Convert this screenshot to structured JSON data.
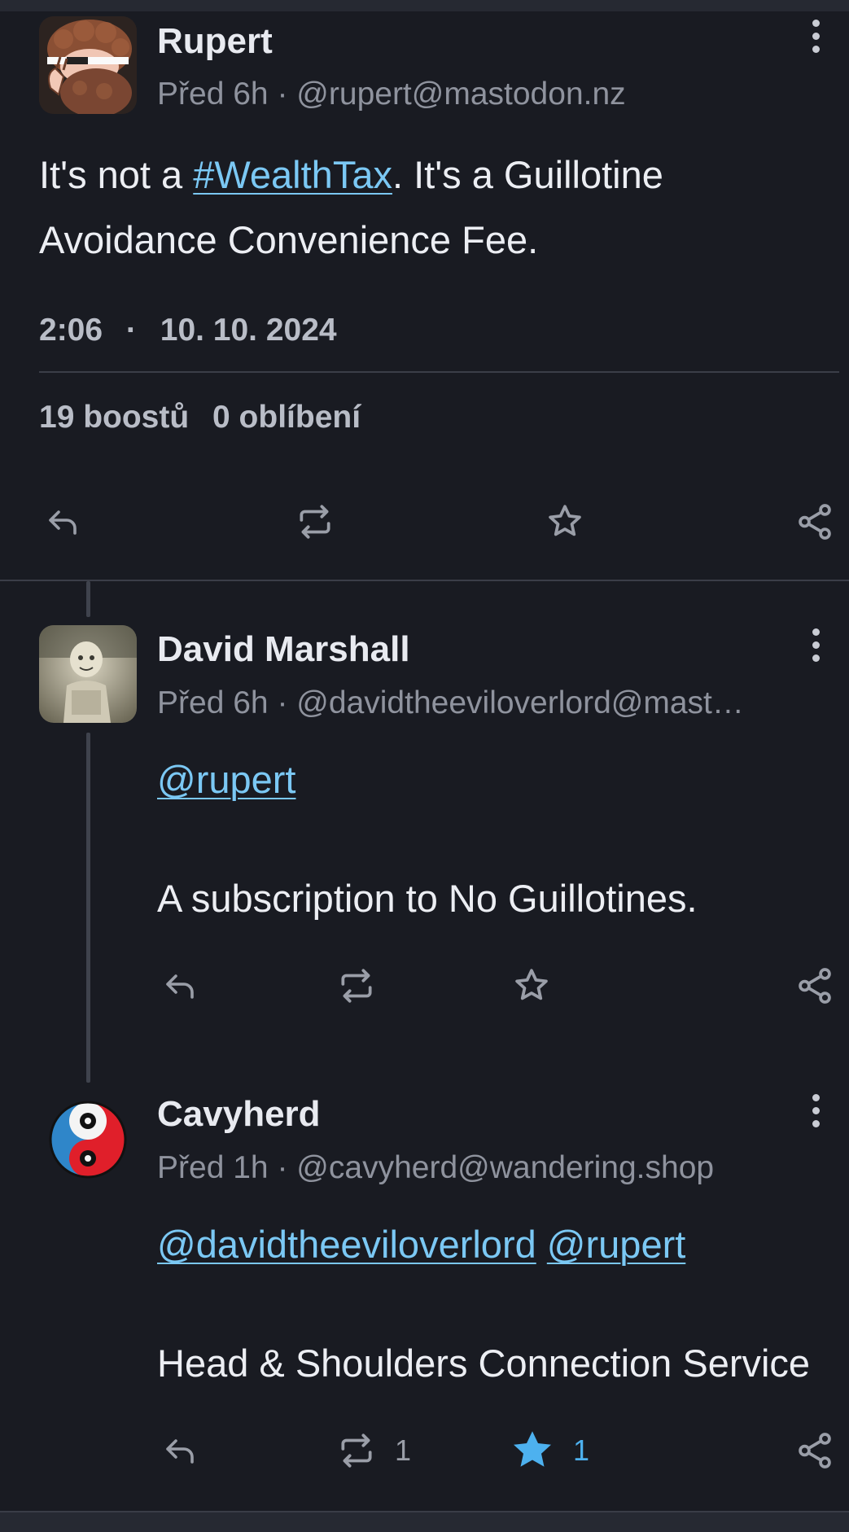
{
  "colors": {
    "background": "#191b22",
    "link": "#7bc8f4",
    "muted": "#8f939e",
    "favourited": "#4db1ef"
  },
  "main_post": {
    "author": "Rupert",
    "time_ago": "Před 6h",
    "separator": "·",
    "handle": "@rupert@mastodon.nz",
    "text_before": "It's not a ",
    "hashtag": "#WealthTax",
    "text_after": ". It's a Guillotine Avoidance Convenience Fee.",
    "time": "2:06",
    "date": "10. 10. 2024",
    "boosts": "19 boostů",
    "favourites": "0 oblíbení",
    "icons": [
      "reply-icon",
      "boost-icon",
      "star-icon",
      "share-icon"
    ]
  },
  "reply1": {
    "author": "David Marshall",
    "time_ago": "Před 6h",
    "separator": "·",
    "handle": "@davidtheeviloverlord@mast…",
    "mention": "@rupert",
    "text": "A subscription to No Guillotines.",
    "icons": [
      "reply-icon",
      "boost-icon",
      "star-icon",
      "share-icon"
    ]
  },
  "reply2": {
    "author": "Cavyherd",
    "time_ago": "Před 1h",
    "separator": "·",
    "handle": "@cavyherd@wandering.shop",
    "mention1": "@davidtheeviloverlord",
    "mention2": "@rupert",
    "text": "Head & Shoulders Connection Service",
    "boost_count": "1",
    "favourite_count": "1",
    "favourited": true,
    "icons": [
      "reply-icon",
      "boost-icon",
      "star-filled-icon",
      "share-icon"
    ]
  }
}
